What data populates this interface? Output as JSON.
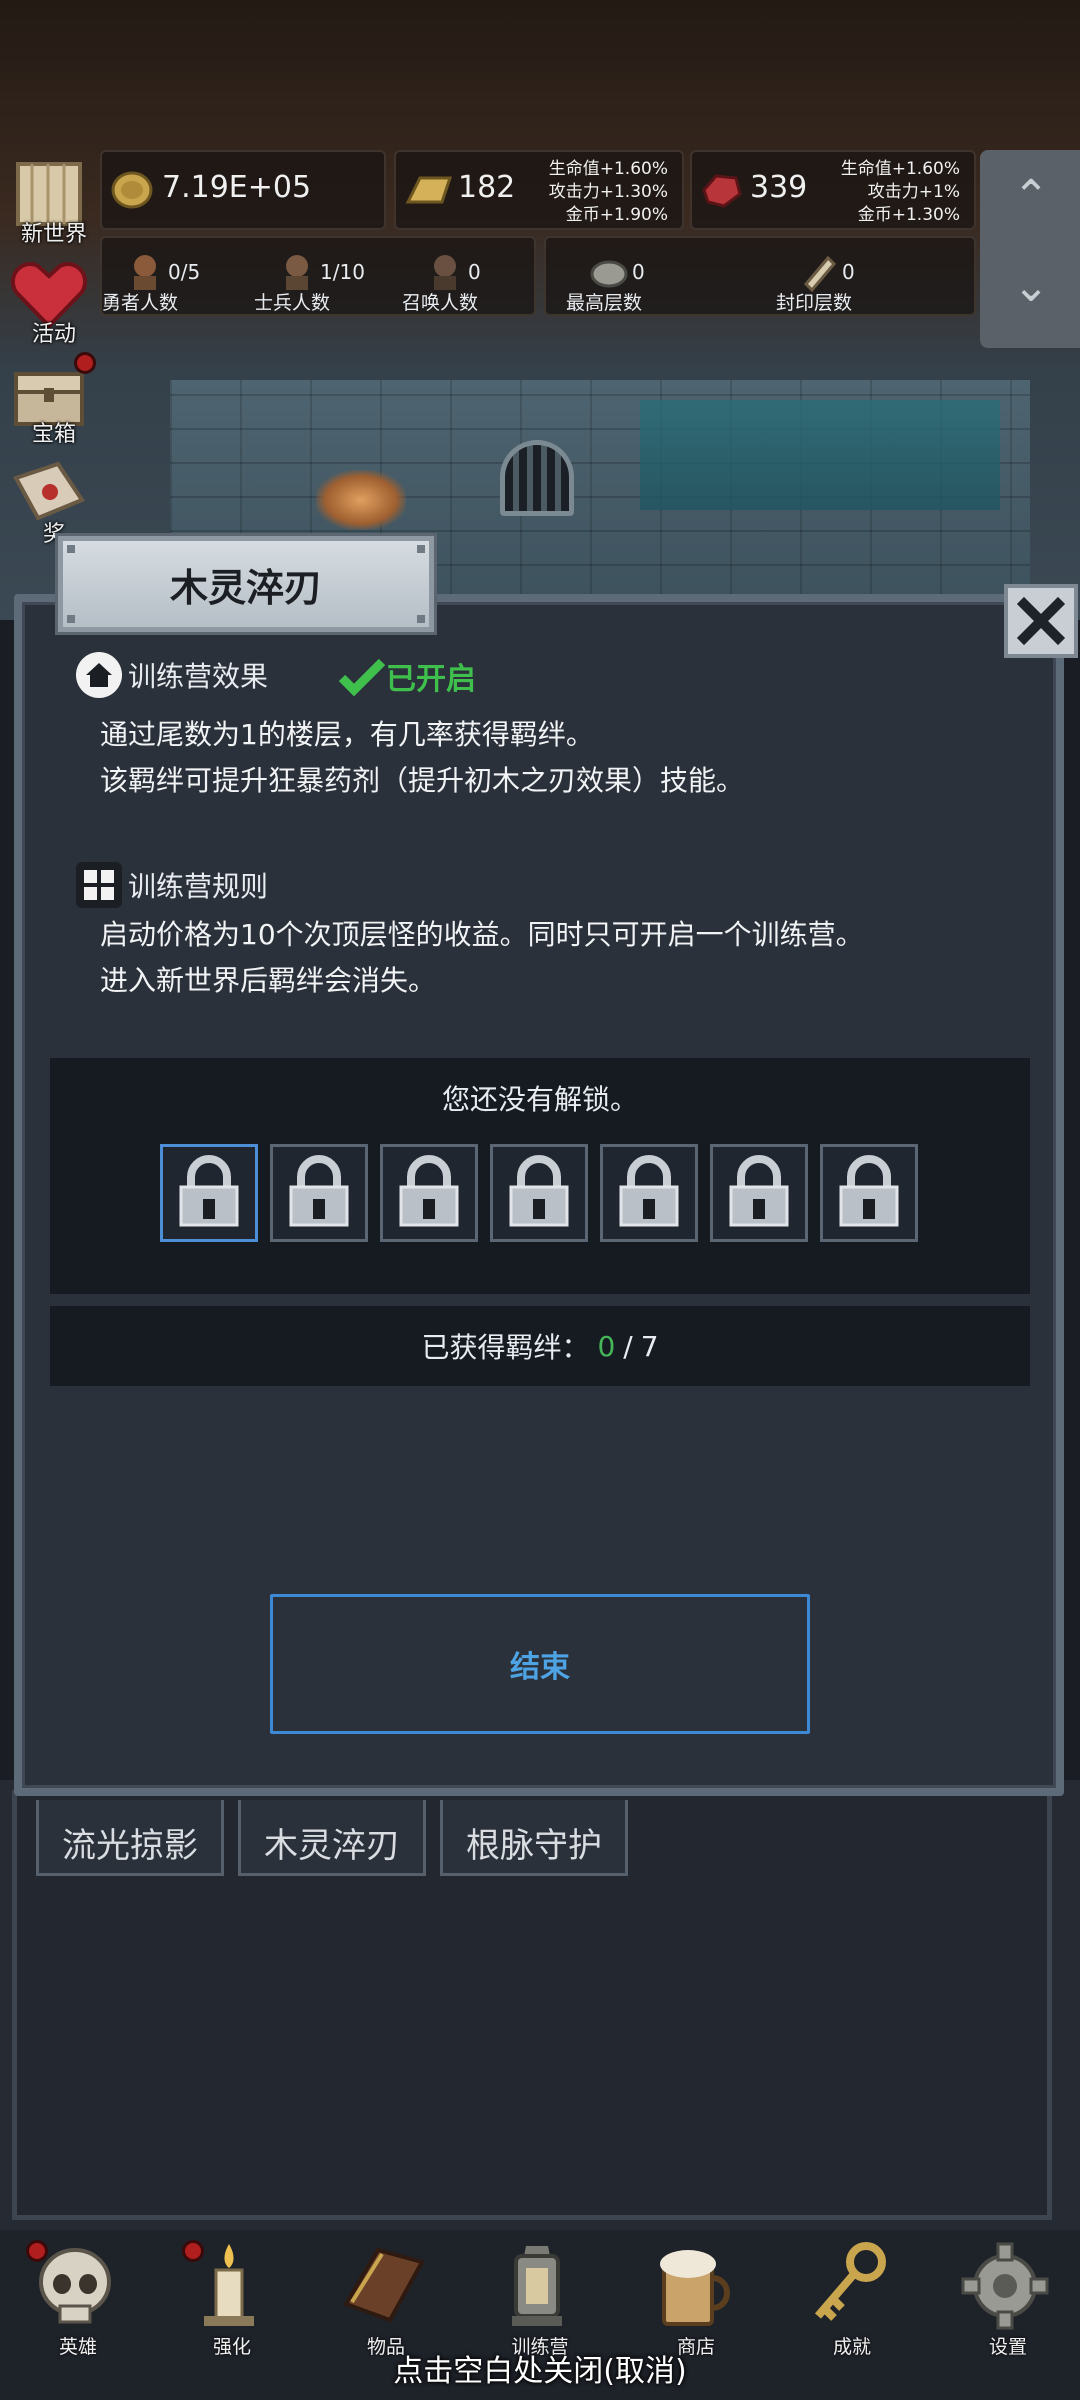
{
  "side_menu": [
    {
      "label": "新世界",
      "icon": "map-scroll-icon"
    },
    {
      "label": "活动",
      "icon": "heart-icon"
    },
    {
      "label": "宝箱",
      "icon": "treasure-chest-icon"
    },
    {
      "label": "奖",
      "icon": "envelope-icon"
    }
  ],
  "resources": {
    "gold": {
      "value": "7.19E+05",
      "icon": "gold-coin-icon"
    },
    "bars": {
      "value": "182",
      "icon": "gold-bar-icon",
      "bonus": [
        "生命值+1.60%",
        "攻击力+1.30%",
        "金币+1.90%"
      ]
    },
    "gems": {
      "value": "339",
      "icon": "red-gem-icon",
      "bonus": [
        "生命值+1.60%",
        "攻击力+1%",
        "金币+1.30%"
      ]
    }
  },
  "stats": [
    {
      "value": "0/5",
      "label": "勇者人数",
      "icon": "hero-portrait-icon"
    },
    {
      "value": "1/10",
      "label": "士兵人数",
      "icon": "soldier-portrait-icon"
    },
    {
      "value": "0",
      "label": "召唤人数",
      "icon": "summon-portrait-icon"
    },
    {
      "value": "0",
      "label": "最高层数",
      "icon": "stone-icon"
    },
    {
      "value": "0",
      "label": "封印层数",
      "icon": "seal-scroll-icon"
    }
  ],
  "background_tabs": [
    "流光掠影",
    "木灵淬刃",
    "根脉守护"
  ],
  "dialog": {
    "title": "木灵淬刃",
    "effect_heading": "训练营效果",
    "status": "已开启",
    "effect_lines": [
      "通过尾数为1的楼层，有几率获得羁绊。",
      "该羁绊可提升狂暴药剂（提升初木之刃效果）技能。"
    ],
    "rules_heading": "训练营规则",
    "rules_lines": [
      "启动价格为10个次顶层怪的收益。同时只可开启一个训练营。",
      "进入新世界后羁绊会消失。"
    ],
    "locked_text": "您还没有解锁。",
    "lock_count": 7,
    "bonds_label": "已获得羁绊：",
    "bonds_current": "0",
    "bonds_sep": "/",
    "bonds_total": "7",
    "end_button": "结束"
  },
  "bottom_nav": [
    {
      "label": "英雄",
      "icon": "skull-icon",
      "badge": true
    },
    {
      "label": "强化",
      "icon": "candle-icon",
      "badge": true
    },
    {
      "label": "物品",
      "icon": "book-icon",
      "badge": false
    },
    {
      "label": "训练营",
      "icon": "lantern-icon",
      "badge": false
    },
    {
      "label": "商店",
      "icon": "beer-mug-icon",
      "badge": false
    },
    {
      "label": "成就",
      "icon": "key-icon",
      "badge": false
    },
    {
      "label": "设置",
      "icon": "gear-icon",
      "badge": false
    }
  ],
  "close_hint": "点击空白处关闭(取消)",
  "colors": {
    "accent_blue": "#4ea3e4",
    "enabled_green": "#3fc04d",
    "badge_red": "#b01e1e"
  }
}
